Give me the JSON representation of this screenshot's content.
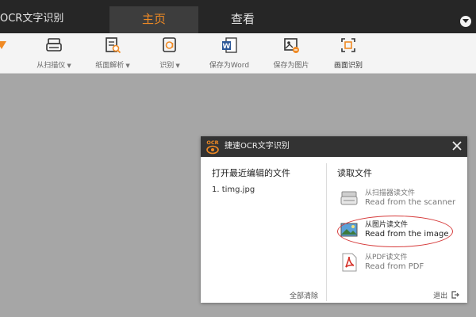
{
  "app": {
    "title": "OCR文字识别"
  },
  "tabs": [
    {
      "label": "主页",
      "active": true
    },
    {
      "label": "查看",
      "active": false
    }
  ],
  "toolbar": {
    "items": [
      {
        "label": "从扫描仪",
        "icon": "scanner-icon",
        "dropdown": true
      },
      {
        "label": "纸面解析",
        "icon": "paper-analysis-icon",
        "dropdown": true
      },
      {
        "label": "识别",
        "icon": "recognize-icon",
        "dropdown": true
      },
      {
        "label": "保存为Word",
        "icon": "word-icon",
        "dropdown": false
      },
      {
        "label": "保存为图片",
        "icon": "save-image-icon",
        "dropdown": false
      },
      {
        "label": "画面识别",
        "icon": "screen-capture-icon",
        "dropdown": false,
        "active": true
      }
    ]
  },
  "dialog": {
    "logo_text": "OCR",
    "title": "捷速OCR文字识别",
    "recent": {
      "heading": "打开最近编辑的文件",
      "items": [
        "1.  timg.jpg"
      ],
      "clear_label": "全部清除"
    },
    "read": {
      "heading": "读取文件",
      "sources": [
        {
          "cn": "从扫描器读文件",
          "en": "Read from the scanner",
          "icon": "scanner-icon"
        },
        {
          "cn": "从图片读文件",
          "en": "Read from the image",
          "icon": "image-icon",
          "highlighted": true
        },
        {
          "cn": "从PDF读文件",
          "en": "Read from PDF",
          "icon": "pdf-icon"
        }
      ]
    },
    "exit_label": "退出"
  },
  "colors": {
    "accent": "#f08a24",
    "titlebar": "#262626",
    "workspace": "#a6a6a6",
    "highlight": "#d63b3b"
  }
}
